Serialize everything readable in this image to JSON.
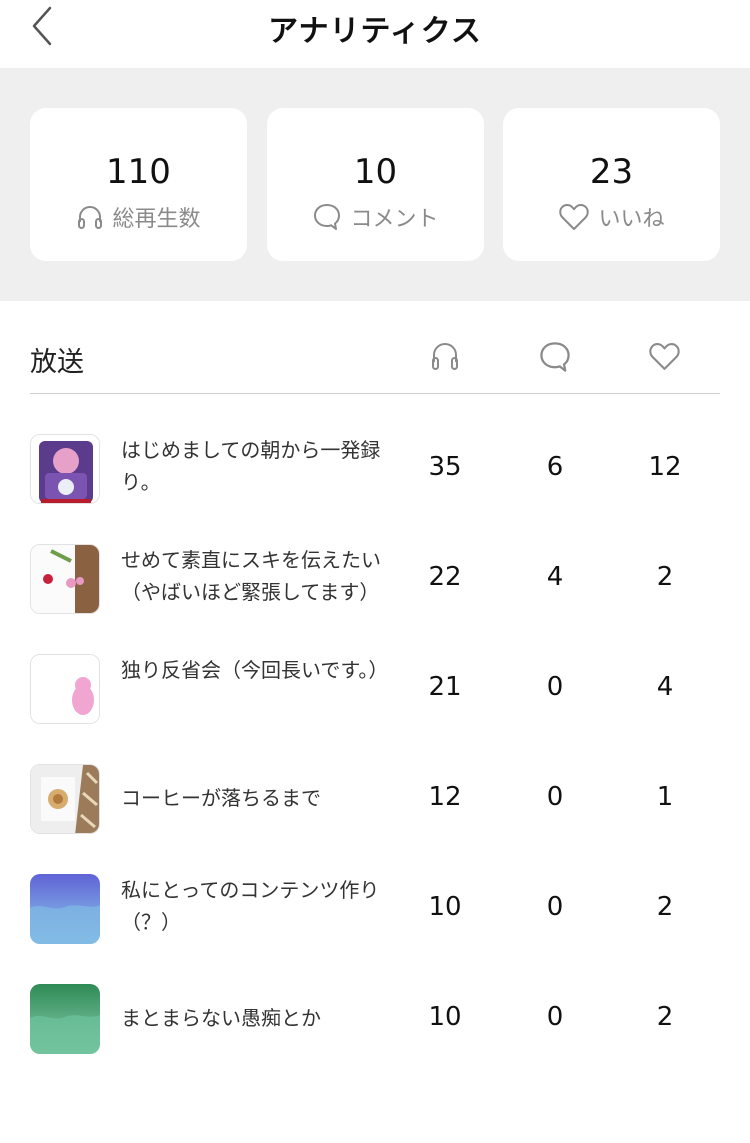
{
  "header": {
    "title": "アナリティクス",
    "back_icon": "chevron-left-icon"
  },
  "summary": [
    {
      "value": "110",
      "label": "総再生数",
      "icon": "headphones-icon"
    },
    {
      "value": "10",
      "label": "コメント",
      "icon": "comment-icon"
    },
    {
      "value": "23",
      "label": "いいね",
      "icon": "heart-icon"
    }
  ],
  "list": {
    "header_label": "放送",
    "column_icons": [
      "headphones-icon",
      "comment-icon",
      "heart-icon"
    ],
    "rows": [
      {
        "title": "はじめましての朝から一発録り。",
        "plays": "35",
        "comments": "6",
        "likes": "12"
      },
      {
        "title": "せめて素直にスキを伝えたい（やばいほど緊張してます）",
        "plays": "22",
        "comments": "4",
        "likes": "2"
      },
      {
        "title": "独り反省会（今回長いです。）",
        "plays": "21",
        "comments": "0",
        "likes": "4"
      },
      {
        "title": "コーヒーが落ちるまで",
        "plays": "12",
        "comments": "0",
        "likes": "1"
      },
      {
        "title": "私にとってのコンテンツ作り（？）",
        "plays": "10",
        "comments": "0",
        "likes": "2"
      },
      {
        "title": "まとまらない愚痴とか",
        "plays": "10",
        "comments": "0",
        "likes": "2"
      }
    ]
  },
  "colors": {
    "summary_bg": "#efefef",
    "card_bg": "#ffffff",
    "label_gray": "#8a8a8a",
    "divider": "#cfcfcf"
  }
}
